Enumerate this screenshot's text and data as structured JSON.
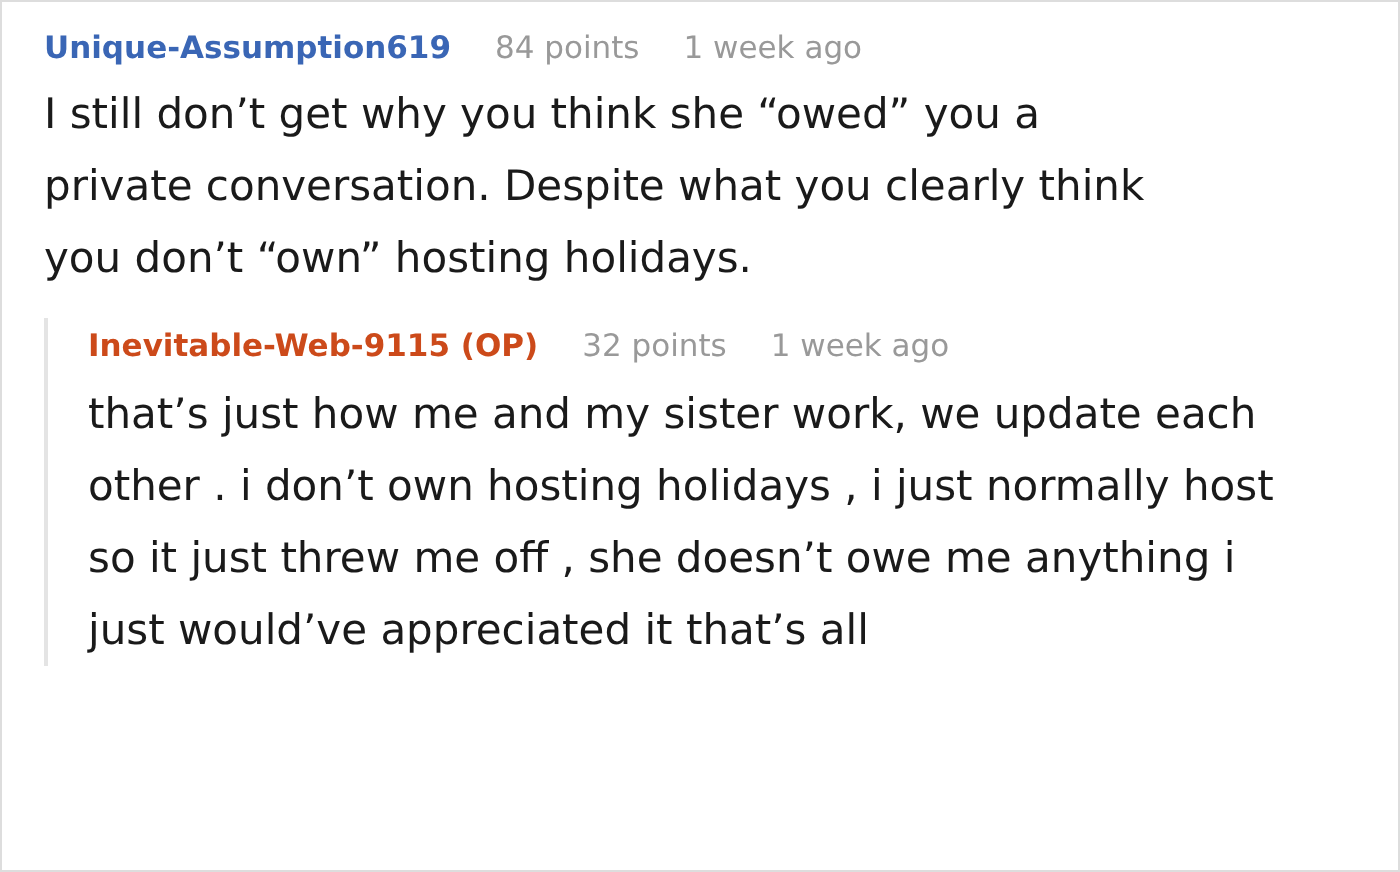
{
  "comments": [
    {
      "author": "Unique-Assumption619",
      "is_op": false,
      "points": "84 points",
      "time": "1 week ago",
      "text": "I still don’t get why you think she “owed” you a private conversation. Despite what you clearly think you don’t “own” hosting holidays.",
      "replies": [
        {
          "author": "Inevitable-Web-9115 (OP)",
          "is_op": true,
          "points": "32 points",
          "time": "1 week ago",
          "text": "that’s just how me and my sister work, we update each other . i don’t own hosting holidays , i just normally host so it just threw me off , she doesn’t owe me anything i just would’ve appreciated it that’s all"
        }
      ]
    }
  ]
}
